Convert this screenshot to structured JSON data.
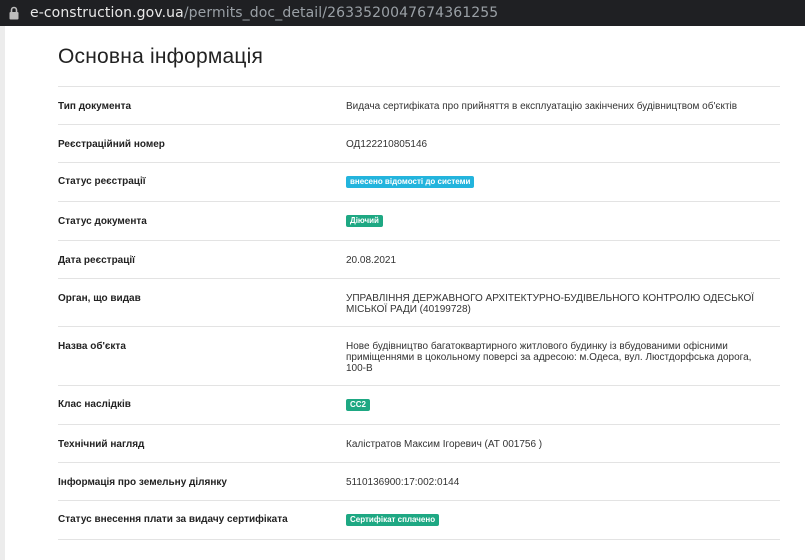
{
  "browser": {
    "url_host": "e-construction.gov.ua",
    "url_path": "/permits_doc_detail/2633520047674361255"
  },
  "page": {
    "title": "Основна інформація"
  },
  "rows": [
    {
      "label": "Тип документа",
      "value": "Видача сертифіката про прийняття в експлуатацію закінчених будівництвом об'єктів"
    },
    {
      "label": "Реєстраційний номер",
      "value": "ОД122210805146"
    },
    {
      "label": "Статус реєстрації",
      "value": "внесено відомості до системи",
      "badge_color": "#23b4dd"
    },
    {
      "label": "Статус документа",
      "value": "Діючий",
      "badge_color": "#1ea883"
    },
    {
      "label": "Дата реєстрації",
      "value": "20.08.2021"
    },
    {
      "label": "Орган, що видав",
      "value": "УПРАВЛІННЯ ДЕРЖАВНОГО АРХІТЕКТУРНО-БУДІВЕЛЬНОГО КОНТРОЛЮ ОДЕСЬКОЇ МІСЬКОЇ РАДИ (40199728)"
    },
    {
      "label": "Назва об'єкта",
      "value": "Нове будівництво багатоквартирного житлового будинку із вбудованими офісними приміщеннями в цокольному поверсі за адресою: м.Одеса, вул. Люстдорфська дорога, 100-В"
    },
    {
      "label": "Клас наслідків",
      "value": "СС2",
      "badge_color": "#1ea883"
    },
    {
      "label": "Технічний нагляд",
      "value": "Калістратов Максим Ігоревич (АТ 001756 )"
    },
    {
      "label": "Інформація про земельну ділянку",
      "value": "5110136900:17:002:0144"
    },
    {
      "label": "Статус внесення плати за видачу сертифіката",
      "value": "Сертифікат сплачено",
      "badge_color": "#1ea883"
    }
  ]
}
